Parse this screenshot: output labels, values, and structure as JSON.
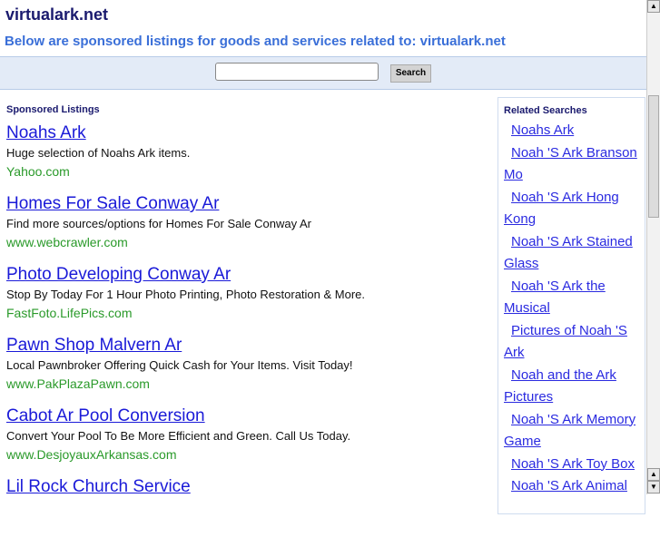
{
  "header": {
    "title": "virtualark.net",
    "subtitle": "Below are sponsored listings for goods and services related to: virtualark.net"
  },
  "search": {
    "value": "",
    "button": "Search"
  },
  "main": {
    "heading": "Sponsored Listings",
    "listings": [
      {
        "title": "Noahs Ark",
        "desc": "Huge selection of Noahs Ark items.",
        "url": "Yahoo.com"
      },
      {
        "title": "Homes For Sale Conway Ar",
        "desc": "Find more sources/options for Homes For Sale Conway Ar",
        "url": "www.webcrawler.com"
      },
      {
        "title": "Photo Developing Conway Ar",
        "desc": "Stop By Today For 1 Hour Photo Printing, Photo Restoration & More.",
        "url": "FastFoto.LifePics.com"
      },
      {
        "title": "Pawn Shop Malvern Ar",
        "desc": "Local Pawnbroker Offering Quick Cash for Your Items. Visit Today!",
        "url": "www.PakPlazaPawn.com"
      },
      {
        "title": "Cabot Ar Pool Conversion",
        "desc": "Convert Your Pool To Be More Efficient and Green. Call Us Today.",
        "url": "www.DesjoyauxArkansas.com"
      },
      {
        "title": "Lil Rock Church Service",
        "desc": "",
        "url": ""
      }
    ]
  },
  "sidebar": {
    "heading": "Related Searches",
    "items": [
      "Noahs Ark",
      "Noah 'S Ark Branson Mo",
      "Noah 'S Ark Hong Kong",
      "Noah 'S Ark Stained Glass",
      "Noah 'S Ark the Musical",
      "Pictures of Noah 'S Ark",
      "Noah and the Ark Pictures",
      "Noah 'S Ark Memory Game",
      "Noah 'S Ark Toy Box",
      "Noah 'S Ark Animal"
    ]
  }
}
